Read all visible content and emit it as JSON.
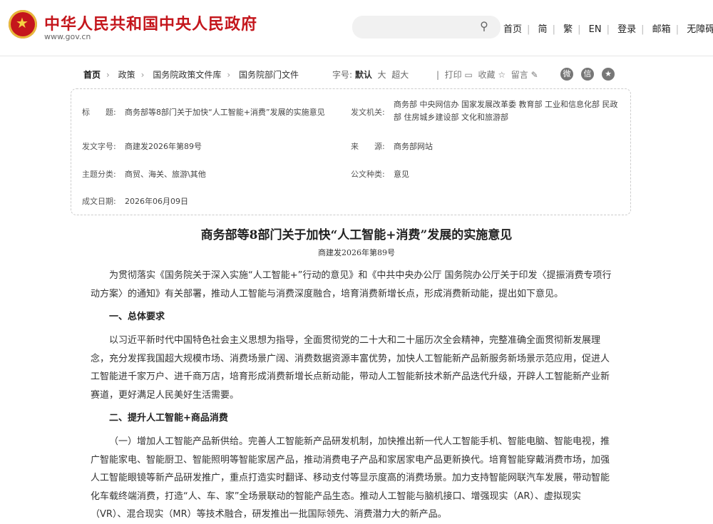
{
  "header": {
    "site_title": "中华人民共和国中央人民政府",
    "site_url": "www.gov.cn",
    "search_placeholder": "",
    "nav": [
      "首页",
      "简",
      "繁",
      "EN",
      "登录",
      "邮箱",
      "无障碍"
    ]
  },
  "breadcrumb": [
    "首页",
    "政策",
    "国务院政策文件库",
    "国务院部门文件"
  ],
  "font_size": {
    "label": "字号:",
    "options": [
      "默认",
      "大",
      "超大"
    ],
    "selected": "默认"
  },
  "tools": {
    "print": "打印",
    "favorite": "收藏",
    "comment": "留言"
  },
  "social_icons": [
    "weibo-icon",
    "wechat-icon",
    "star-icon"
  ],
  "meta": {
    "title_label": "标　　题:",
    "title": "商务部等8部门关于加快“人工智能+消费”发展的实施意见",
    "issuer_label": "发文机关:",
    "issuer": "商务部 中央网信办 国家发展改革委 教育部 工业和信息化部 民政部 住房城乡建设部 文化和旅游部",
    "doc_no_label": "发文字号:",
    "doc_no": "商建发2026年第89号",
    "source_label": "来　　源:",
    "source": "商务部网站",
    "category_label": "主题分类:",
    "category": "商贸、海关、旅游\\其他",
    "type_label": "公文种类:",
    "type": "意见",
    "date_label": "成文日期:",
    "date": "2026年06月09日"
  },
  "article": {
    "title": "商务部等8部门关于加快“人工智能+消费”发展的实施意见",
    "doc_no": "商建发2026年第89号",
    "p1": "为贯彻落实《国务院关于深入实施“人工智能+”行动的意见》和《中共中央办公厅 国务院办公厅关于印发〈提振消费专项行动方案〉的通知》有关部署，推动人工智能与消费深度融合，培育消费新增长点，形成消费新动能，提出如下意见。",
    "h1": "一、总体要求",
    "p2": "以习近平新时代中国特色社会主义思想为指导，全面贯彻党的二十大和二十届历次全会精神，完整准确全面贯彻新发展理念，充分发挥我国超大规模市场、消费场景广阔、消费数据资源丰富优势，加快人工智能新产品新服务新场景示范应用，促进人工智能进千家万户、进千商万店，培育形成消费新增长点新动能，带动人工智能新技术新产品迭代升级，开辟人工智能新产业新赛道，更好满足人民美好生活需要。",
    "h2": "二、提升人工智能+商品消费",
    "p3": "（一）增加人工智能产品新供给。完善人工智能新产品研发机制，加快推出新一代人工智能手机、智能电脑、智能电视，推广智能家电、智能厨卫、智能照明等智能家居产品，推动消费电子产品和家居家电产品更新换代。培育智能穿戴消费市场，加强人工智能眼镜等新产品研发推广，重点打造实时翻译、移动支付等显示度高的消费场景。加力支持智能网联汽车发展，带动智能化车载终端消费，打造“人、车、家”全场景联动的智能产品生态。推动人工智能与脑机接口、增强现实（AR）、虚拟现实（VR）、混合现实（MR）等技术融合，研发推出一批国际领先、消费潜力大的新产品。"
  }
}
